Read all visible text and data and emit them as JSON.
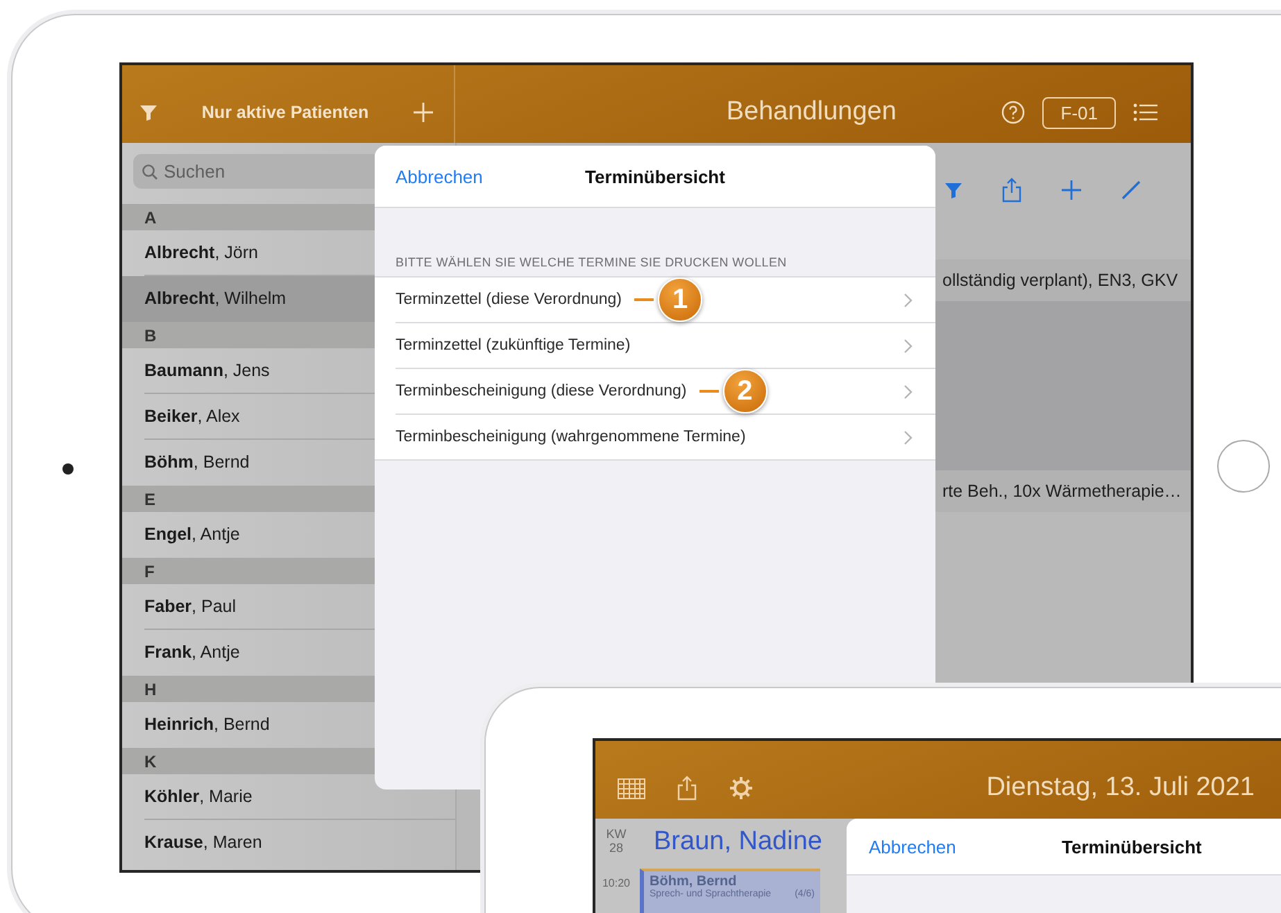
{
  "main_device": {
    "sidebar": {
      "filter_label": "Nur aktive Patienten",
      "search": {
        "placeholder": "Suchen"
      },
      "sections": [
        {
          "letter": "A",
          "patients": [
            {
              "name": "**Albrecht**, Jörn",
              "selected": false
            },
            {
              "name": "**Albrecht**, Wilhelm",
              "selected": true
            }
          ]
        },
        {
          "letter": "B",
          "patients": [
            {
              "name": "**Baumann**, Jens",
              "selected": false
            },
            {
              "name": "**Beiker**, Alex",
              "selected": false
            },
            {
              "name": "**Böhm**, Bernd",
              "selected": false
            }
          ]
        },
        {
          "letter": "E",
          "patients": [
            {
              "name": "**Engel**, Antje",
              "selected": false
            }
          ]
        },
        {
          "letter": "F",
          "patients": [
            {
              "name": "**Faber**, Paul",
              "selected": false
            },
            {
              "name": "**Frank**, Antje",
              "selected": false
            }
          ]
        },
        {
          "letter": "H",
          "patients": [
            {
              "name": "**Heinrich**, Bernd",
              "selected": false
            }
          ]
        },
        {
          "letter": "K",
          "patients": [
            {
              "name": "**Köhler**, Marie",
              "selected": false
            },
            {
              "name": "**Krause**, Maren",
              "selected": false
            }
          ]
        }
      ]
    },
    "header": {
      "title": "Behandlungen",
      "badge": "F-01"
    },
    "treatments": [
      {
        "text": "ollständig verplant), EN3, GKV",
        "selected": false
      },
      {
        "selected": true
      },
      {
        "text": "rte Beh., 10x Wärmetherapie…",
        "selected": false
      }
    ],
    "dialog": {
      "cancel": "Abbrechen",
      "title": "Terminübersicht",
      "section_label": "BITTE WÄHLEN SIE WELCHE TERMINE SIE DRUCKEN WOLLEN",
      "options": [
        {
          "label": "Terminzettel (diese Verordnung)",
          "callout": "1"
        },
        {
          "label": "Terminzettel (zukünftige Termine)"
        },
        {
          "label": "Terminbescheinigung (diese Verordnung)",
          "callout": "2"
        },
        {
          "label": "Terminbescheinigung (wahrgenommene Termine)"
        }
      ]
    }
  },
  "second_device": {
    "date": "Dienstag, 13. Juli 2021",
    "week_label": "KW",
    "week_number": "28",
    "therapist": "Braun, Nadine",
    "time": "10:20",
    "appointment": {
      "patient": "Böhm, Bernd",
      "therapy": "Sprech- und Sprachtherapie",
      "count": "(4/6)"
    },
    "dialog": {
      "cancel": "Abbrechen",
      "title": "Terminübersicht"
    }
  }
}
